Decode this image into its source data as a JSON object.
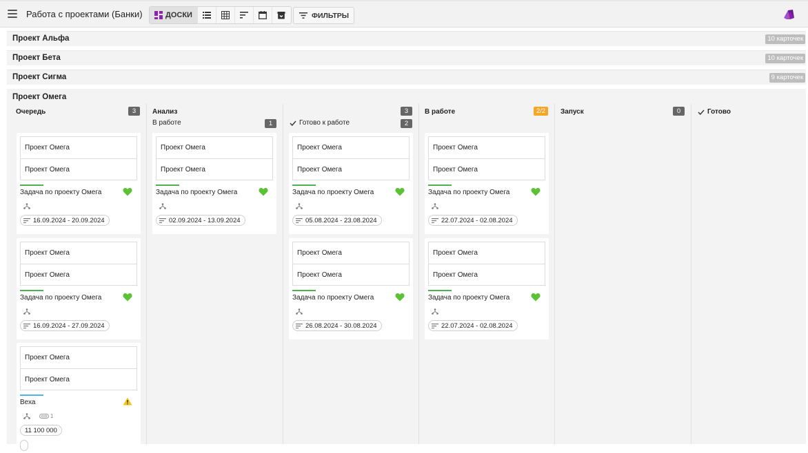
{
  "app": {
    "title": "Работа с проектами (Банки)"
  },
  "toolbar": {
    "boards_label": "ДОСКИ",
    "filters_label": "ФИЛЬТРЫ",
    "view_icons": [
      "board-icon",
      "list-icon",
      "table-icon",
      "sort-icon",
      "calendar-icon",
      "archive-icon"
    ]
  },
  "groups": [
    {
      "title": "Проект Альфа",
      "count": "10 карточек"
    },
    {
      "title": "Проект Бета",
      "count": "10 карточек"
    },
    {
      "title": "Проект Сигма",
      "count": "9 карточек"
    }
  ],
  "omega": {
    "title": "Проект Омега",
    "columns": [
      {
        "title": "Очередь",
        "count": "3"
      },
      {
        "title": "Анализ",
        "sub": [
          {
            "title": "В работе",
            "count": "1"
          },
          {
            "title": "Готово к работе",
            "count": "2"
          }
        ]
      },
      {
        "title": "В работе",
        "count": "2/2"
      },
      {
        "title": "Запуск",
        "count": "0"
      },
      {
        "title": "Готово"
      }
    ],
    "cards": {
      "q1": {
        "f1": "Проект Омега",
        "f2": "Проект Омега",
        "title": "Задача по проекту Омега",
        "dates": "16.09.2024 - 20.09.2024"
      },
      "q2": {
        "f1": "Проект Омега",
        "f2": "Проект Омега",
        "title": "Задача по проекту Омега",
        "dates": "16.09.2024 - 27.09.2024"
      },
      "q3": {
        "f1": "Проект Омега",
        "f2": "Проект Омега",
        "title": "Веха",
        "attachments": "1",
        "value": "11 100 000",
        "dates": ""
      },
      "a1": {
        "f1": "Проект Омега",
        "f2": "Проект Омега",
        "title": "Задача по проекту Омега",
        "dates": "02.09.2024 - 13.09.2024"
      },
      "r1": {
        "f1": "Проект Омега",
        "f2": "Проект Омега",
        "title": "Задача по проекту Омега",
        "dates": "05.08.2024 - 23.08.2024"
      },
      "r2": {
        "f1": "Проект Омега",
        "f2": "Проект Омега",
        "title": "Задача по проекту Омега",
        "dates": "26.08.2024 - 30.08.2024"
      },
      "w1": {
        "f1": "Проект Омега",
        "f2": "Проект Омега",
        "title": "Задача по проекту Омега",
        "dates": "22.07.2024 - 02.08.2024"
      },
      "w2": {
        "f1": "Проект Омега",
        "f2": "Проект Омега",
        "title": "Задача по проекту Омега",
        "dates": "22.07.2024 - 02.08.2024"
      }
    }
  },
  "colors": {
    "accent": "#8e24aa",
    "progress": "#4caf50",
    "milestone": "#4db6e8",
    "wip": "#f5a623",
    "count_badge": "#666666"
  }
}
